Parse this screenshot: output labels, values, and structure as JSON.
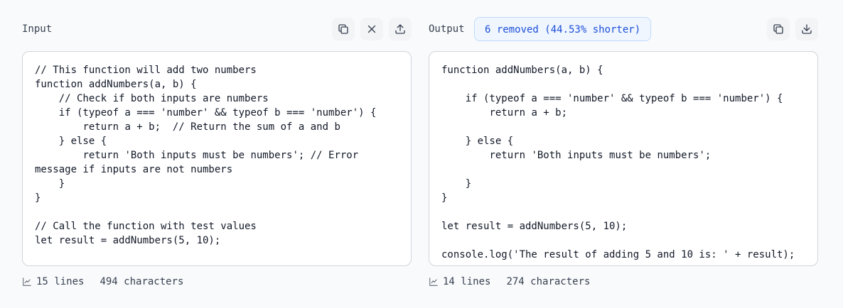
{
  "input": {
    "label": "Input",
    "code": "// This function will add two numbers\nfunction addNumbers(a, b) {\n    // Check if both inputs are numbers\n    if (typeof a === 'number' && typeof b === 'number') {\n        return a + b;  // Return the sum of a and b\n    } else {\n        return 'Both inputs must be numbers'; // Error message if inputs are not numbers\n    }\n}\n\n// Call the function with test values\nlet result = addNumbers(5, 10);",
    "lines": "15 lines",
    "chars": "494 characters",
    "icons": [
      "copy-icon",
      "close-icon",
      "upload-icon"
    ]
  },
  "output": {
    "label": "Output",
    "badge": "6 removed (44.53% shorter)",
    "code": "function addNumbers(a, b) {\n\n    if (typeof a === 'number' && typeof b === 'number') {\n        return a + b;\n\n    } else {\n        return 'Both inputs must be numbers';\n\n    }\n}\n\nlet result = addNumbers(5, 10);\n\nconsole.log('The result of adding 5 and 10 is: ' + result);",
    "lines": "14 lines",
    "chars": "274 characters",
    "icons": [
      "copy-icon",
      "download-icon"
    ]
  }
}
